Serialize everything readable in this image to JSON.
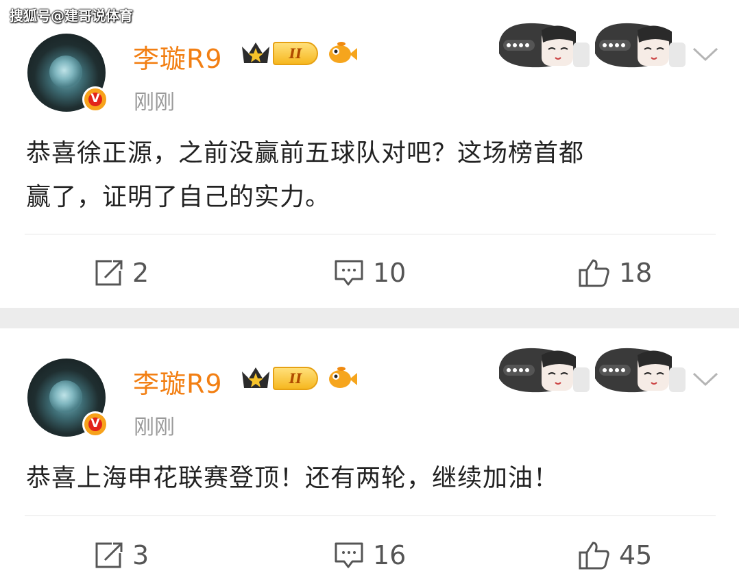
{
  "watermark": "搜狐号@建哥说体育",
  "posts": [
    {
      "username": "李璇R9",
      "vip_badge": "V",
      "level": "II",
      "timestamp": "刚刚",
      "content_lines": [
        "恭喜徐正源，之前没赢前五球队对吧？这场榜首都",
        "赢了，证明了自己的实力。"
      ],
      "reposts": "2",
      "comments": "10",
      "likes": "18"
    },
    {
      "username": "李璇R9",
      "vip_badge": "V",
      "level": "II",
      "timestamp": "刚刚",
      "content_lines": [
        "恭喜上海申花联赛登顶！还有两轮，继续加油！"
      ],
      "reposts": "3",
      "comments": "16",
      "likes": "45"
    }
  ],
  "colors": {
    "username": "#f27f13",
    "timestamp": "#9a9a9a",
    "separator_bg": "#ececec"
  },
  "icons": [
    "repost-icon",
    "comment-icon",
    "like-icon",
    "chevron-down-icon",
    "crown-icon",
    "fish-icon",
    "sticker-decoration"
  ]
}
